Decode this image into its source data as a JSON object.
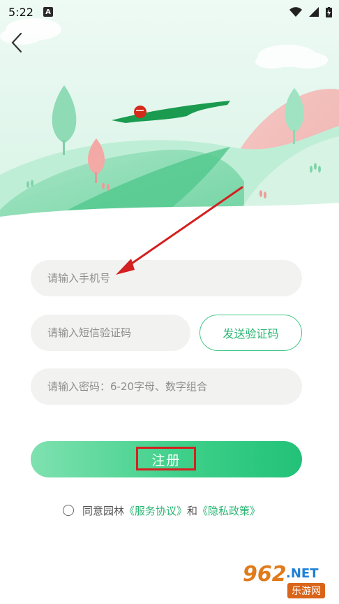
{
  "status_bar": {
    "time": "5:22",
    "notification_letter": "A",
    "icons": [
      "wifi-icon",
      "signal-icon",
      "battery-charging-icon"
    ]
  },
  "nav": {
    "back_icon": "chevron-left-icon"
  },
  "form": {
    "phone_placeholder": "请输入手机号",
    "code_placeholder": "请输入短信验证码",
    "send_code_label": "发送验证码",
    "password_placeholder": "请输入密码：6-20字母、数字组合"
  },
  "register_label": "注册",
  "agreement": {
    "prefix": "同意园林",
    "terms": "《服务协议》",
    "and": "和",
    "privacy": "《隐私政策》"
  },
  "watermark": {
    "big": "962",
    "net": ".NET",
    "sub": "乐游网"
  },
  "colors": {
    "accent": "#2bb673",
    "button_gradient_start": "#7fe1b0",
    "button_gradient_end": "#22c278",
    "annotation_red": "#d42020"
  }
}
